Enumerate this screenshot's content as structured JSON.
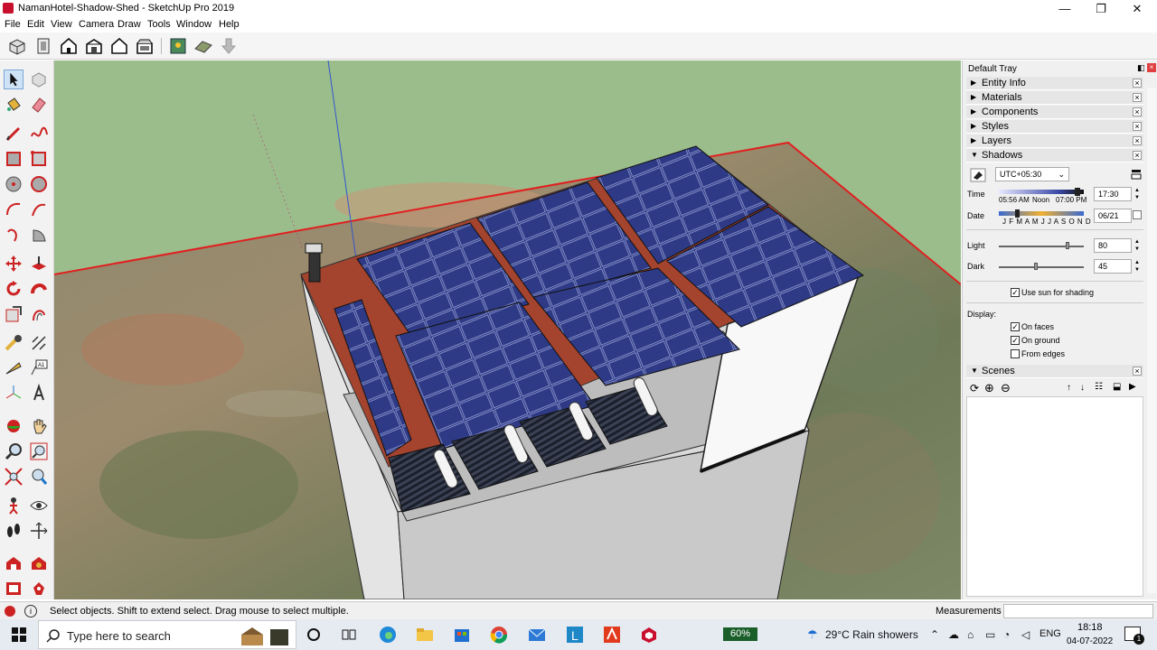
{
  "window": {
    "title": "NamanHotel-Shadow-Shed - SketchUp Pro 2019",
    "minimize": "—",
    "maximize": "❐",
    "close": "✕"
  },
  "menu": [
    "File",
    "Edit",
    "View",
    "Camera",
    "Draw",
    "Tools",
    "Window",
    "Help"
  ],
  "tray": {
    "title": "Default Tray",
    "panels": [
      "Entity Info",
      "Materials",
      "Components",
      "Styles",
      "Layers"
    ],
    "shadows": {
      "label": "Shadows",
      "timezone": "UTC+05:30",
      "time_label": "Time",
      "time_start": "05:56 AM",
      "time_noon": "Noon",
      "time_end": "07:00 PM",
      "time_value": "17:30",
      "date_label": "Date",
      "months": "J F M A M J J A S O N D",
      "date_value": "06/21",
      "light_label": "Light",
      "light_value": "80",
      "light_level": 0.8,
      "dark_label": "Dark",
      "dark_value": "45",
      "dark_level": 0.45,
      "use_sun_label": "Use sun for shading",
      "use_sun": true,
      "display_label": "Display:",
      "on_faces_label": "On faces",
      "on_faces": true,
      "on_ground_label": "On ground",
      "on_ground": true,
      "from_edges_label": "From edges",
      "from_edges": false
    },
    "scenes_label": "Scenes"
  },
  "status": {
    "message": "Select objects. Shift to extend select. Drag mouse to select multiple.",
    "measurements_label": "Measurements"
  },
  "taskbar": {
    "search_placeholder": "Type here to search",
    "battery": "60%",
    "weather": "29°C  Rain showers",
    "language": "ENG",
    "time": "18:18",
    "date": "04-07-2022",
    "notification_count": "1"
  },
  "colors": {
    "sky": "#9bbd8c",
    "panel": "#2a3470",
    "roof": "#a4432e",
    "accent_red": "#c8102e"
  }
}
